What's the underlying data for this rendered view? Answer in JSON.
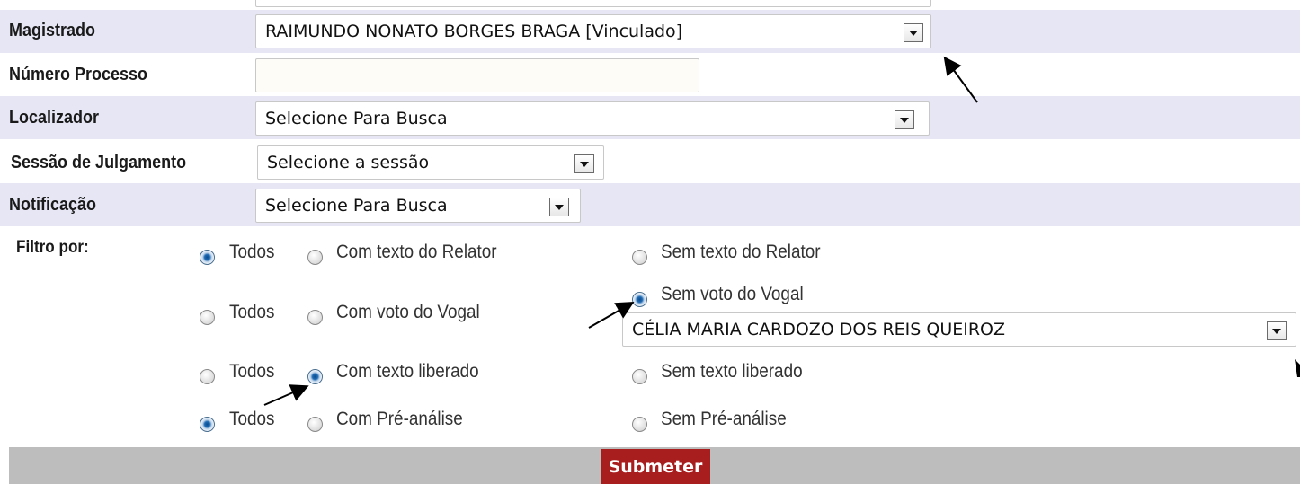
{
  "form": {
    "magistrado": {
      "label": "Magistrado",
      "value": "RAIMUNDO NONATO BORGES BRAGA [Vinculado]"
    },
    "numero_processo": {
      "label": "Número Processo",
      "value": ""
    },
    "localizador": {
      "label": "Localizador",
      "value": "Selecione Para Busca"
    },
    "sessao": {
      "label": "Sessão de Julgamento",
      "value": "Selecione a sessão"
    },
    "notificacao": {
      "label": "Notificação",
      "value": "Selecione Para Busca"
    },
    "filtro_label": "Filtro por:",
    "filters": [
      {
        "todos": "Todos",
        "com": "Com texto do Relator",
        "sem": "Sem texto do Relator",
        "selected": "todos"
      },
      {
        "todos": "Todos",
        "com": "Com voto do Vogal",
        "sem": "Sem voto do Vogal",
        "selected": "sem"
      },
      {
        "todos": "Todos",
        "com": "Com texto liberado",
        "sem": "Sem texto liberado",
        "selected": "com"
      },
      {
        "todos": "Todos",
        "com": "Com Pré-análise",
        "sem": "Sem Pré-análise",
        "selected": "todos"
      }
    ],
    "vogal_select": {
      "value": "CÉLIA MARIA CARDOZO DOS REIS QUEIROZ"
    },
    "submit_label": "Submeter"
  },
  "colors": {
    "band": "#e6e6f5",
    "footer": "#bdbdbd",
    "submit": "#a81d1d",
    "radio_selected": "#1f6ab4"
  }
}
